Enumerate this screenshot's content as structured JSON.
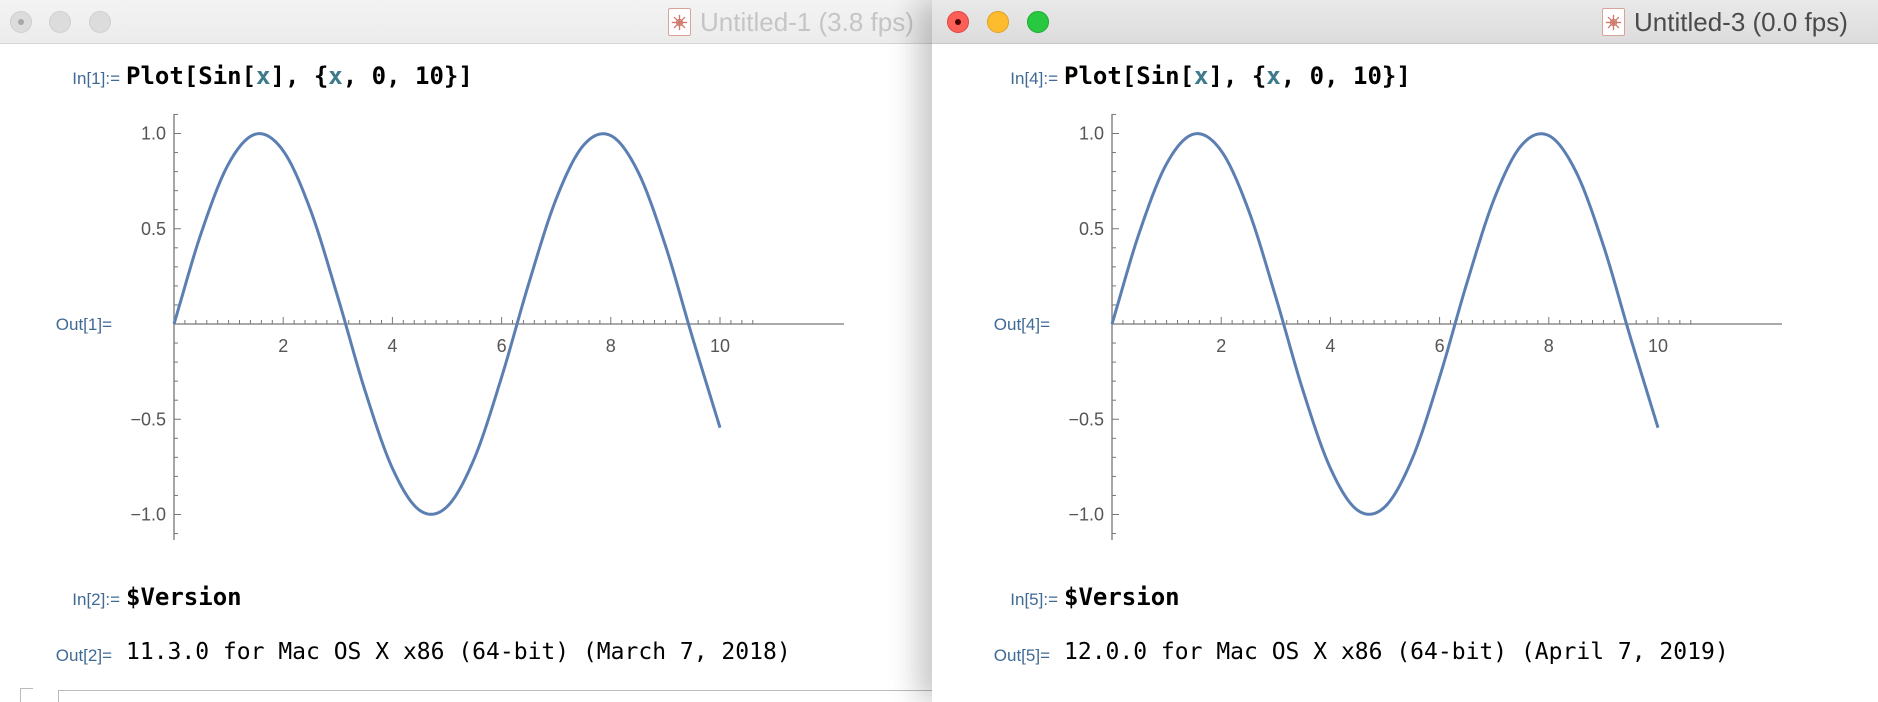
{
  "windows": [
    {
      "title": "Untitled-1 (3.8 fps)",
      "active": false,
      "cells": {
        "plot_input_label": "In[1]:=",
        "plot_input": {
          "a": "Plot[Sin[",
          "b": "x",
          "c": "], {",
          "d": "x",
          "e": ", 0, 10}]"
        },
        "plot_output_label": "Out[1]=",
        "version_input_label": "In[2]:=",
        "version_input": "$Version",
        "version_output_label": "Out[2]=",
        "version_output": "11.3.0 for Mac OS X x86 (64-bit) (March 7, 2018)"
      }
    },
    {
      "title": "Untitled-3 (0.0 fps)",
      "active": true,
      "cells": {
        "plot_input_label": "In[4]:=",
        "plot_input": {
          "a": "Plot[Sin[",
          "b": "x",
          "c": "], {",
          "d": "x",
          "e": ", 0, 10}]"
        },
        "plot_output_label": "Out[4]=",
        "version_input_label": "In[5]:=",
        "version_input": "$Version",
        "version_output_label": "Out[5]=",
        "version_output": "12.0.0 for Mac OS X x86 (64-bit) (April 7, 2019)"
      }
    }
  ],
  "icons": {
    "traffic_lights": [
      "close-icon",
      "minimize-icon",
      "zoom-icon"
    ],
    "document": "mathematica-document-icon"
  },
  "colors": {
    "curve": "#5b7fb3",
    "label": "#3f6a95",
    "variable": "#3d7b8c",
    "close": "#fc5f57",
    "minimize": "#fdbc2e",
    "zoom": "#28c840"
  },
  "chart_data": [
    {
      "type": "line",
      "function": "Sin[x]",
      "x_range": [
        0,
        10
      ],
      "ylim": [
        -1.1,
        1.1
      ],
      "x_ticks": [
        "2",
        "4",
        "6",
        "8",
        "10"
      ],
      "y_ticks": [
        "1.0",
        "0.5",
        "−0.5",
        "−1.0"
      ],
      "x": [
        0,
        0.5,
        1,
        1.5,
        2,
        2.5,
        3,
        3.5,
        4,
        4.5,
        5,
        5.5,
        6,
        6.5,
        7,
        7.5,
        8,
        8.5,
        9,
        9.5,
        10
      ],
      "series": [
        {
          "values": [
            0,
            0.479,
            0.841,
            0.997,
            0.909,
            0.598,
            0.141,
            -0.351,
            -0.757,
            -0.978,
            -0.959,
            -0.706,
            -0.279,
            0.215,
            0.657,
            0.938,
            0.989,
            0.798,
            0.412,
            -0.075,
            -0.544
          ]
        }
      ]
    },
    {
      "type": "line",
      "function": "Sin[x]",
      "x_range": [
        0,
        10
      ],
      "ylim": [
        -1.1,
        1.1
      ],
      "x_ticks": [
        "2",
        "4",
        "6",
        "8",
        "10"
      ],
      "y_ticks": [
        "1.0",
        "0.5",
        "−0.5",
        "−1.0"
      ],
      "x": [
        0,
        0.5,
        1,
        1.5,
        2,
        2.5,
        3,
        3.5,
        4,
        4.5,
        5,
        5.5,
        6,
        6.5,
        7,
        7.5,
        8,
        8.5,
        9,
        9.5,
        10
      ],
      "series": [
        {
          "values": [
            0,
            0.479,
            0.841,
            0.997,
            0.909,
            0.598,
            0.141,
            -0.351,
            -0.757,
            -0.978,
            -0.959,
            -0.706,
            -0.279,
            0.215,
            0.657,
            0.938,
            0.989,
            0.798,
            0.412,
            -0.075,
            -0.544
          ]
        }
      ]
    }
  ]
}
